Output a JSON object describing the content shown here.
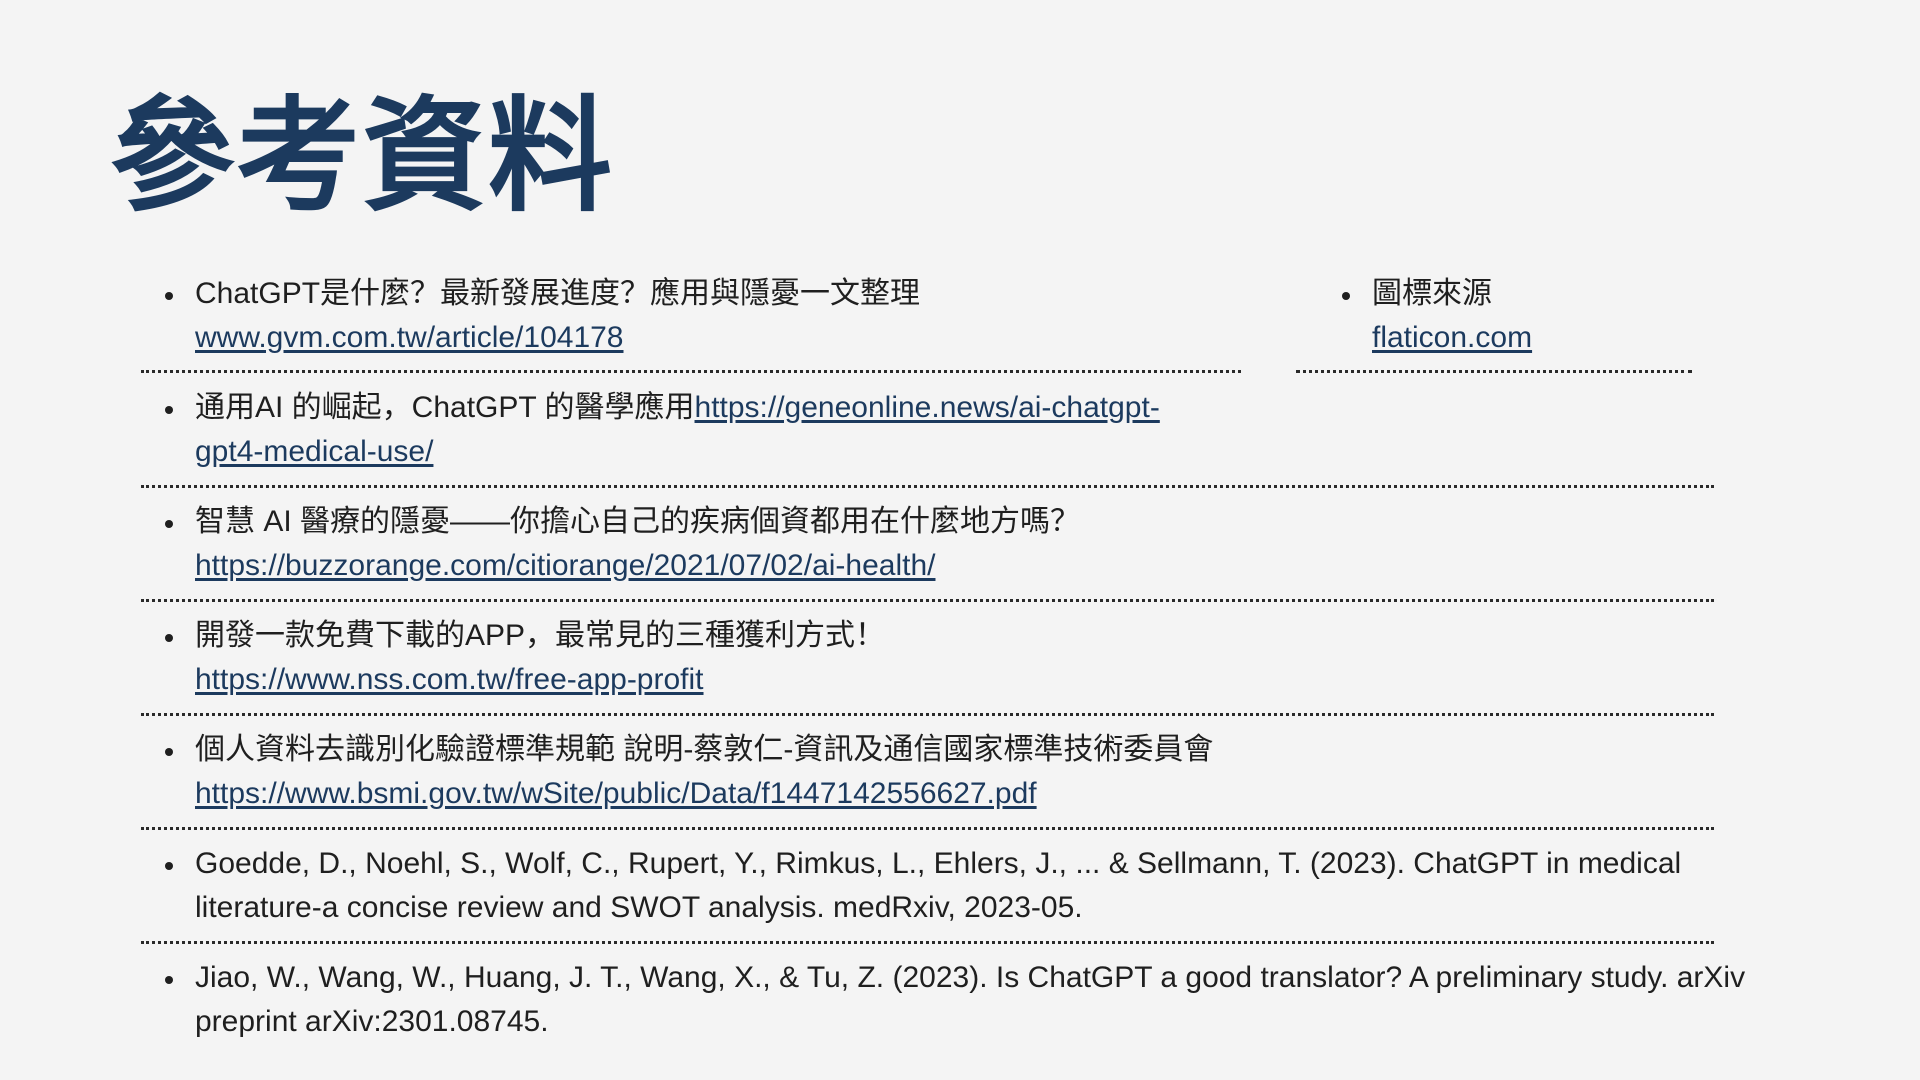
{
  "title": "參考資料",
  "references": [
    {
      "text": "ChatGPT是什麼？最新發展進度？應用與隱憂一文整理",
      "link": "www.gvm.com.tw/article/104178"
    },
    {
      "text": "圖標來源",
      "link": "flaticon.com"
    },
    {
      "text": "通用AI 的崛起，ChatGPT 的醫學應用",
      "link_line1": "https://geneonline.news/ai-chatgpt-",
      "link_line2": "gpt4-medical-use/"
    },
    {
      "text": "智慧 AI 醫療的隱憂——你擔心自己的疾病個資都用在什麼地方嗎？",
      "link": "https://buzzorange.com/citiorange/2021/07/02/ai-health/"
    },
    {
      "text": "開發一款免費下載的APP，最常見的三種獲利方式！",
      "link": "https://www.nss.com.tw/free-app-profit"
    },
    {
      "text": "個人資料去識別化驗證標準規範 說明-蔡敦仁-資訊及通信國家標準技術委員會",
      "link": "https://www.bsmi.gov.tw/wSite/public/Data/f1447142556627.pdf"
    },
    {
      "line1": "Goedde, D., Noehl, S., Wolf, C., Rupert, Y., Rimkus, L., Ehlers, J., ... & Sellmann, T. (2023). ChatGPT in medical",
      "line2": "literature-a concise review and SWOT analysis. medRxiv, 2023-05."
    },
    {
      "line1": "Jiao, W., Wang, W., Huang, J. T., Wang, X., & Tu, Z. (2023). Is ChatGPT a good translator? A preliminary study. arXiv",
      "line2": "preprint arXiv:2301.08745."
    }
  ]
}
